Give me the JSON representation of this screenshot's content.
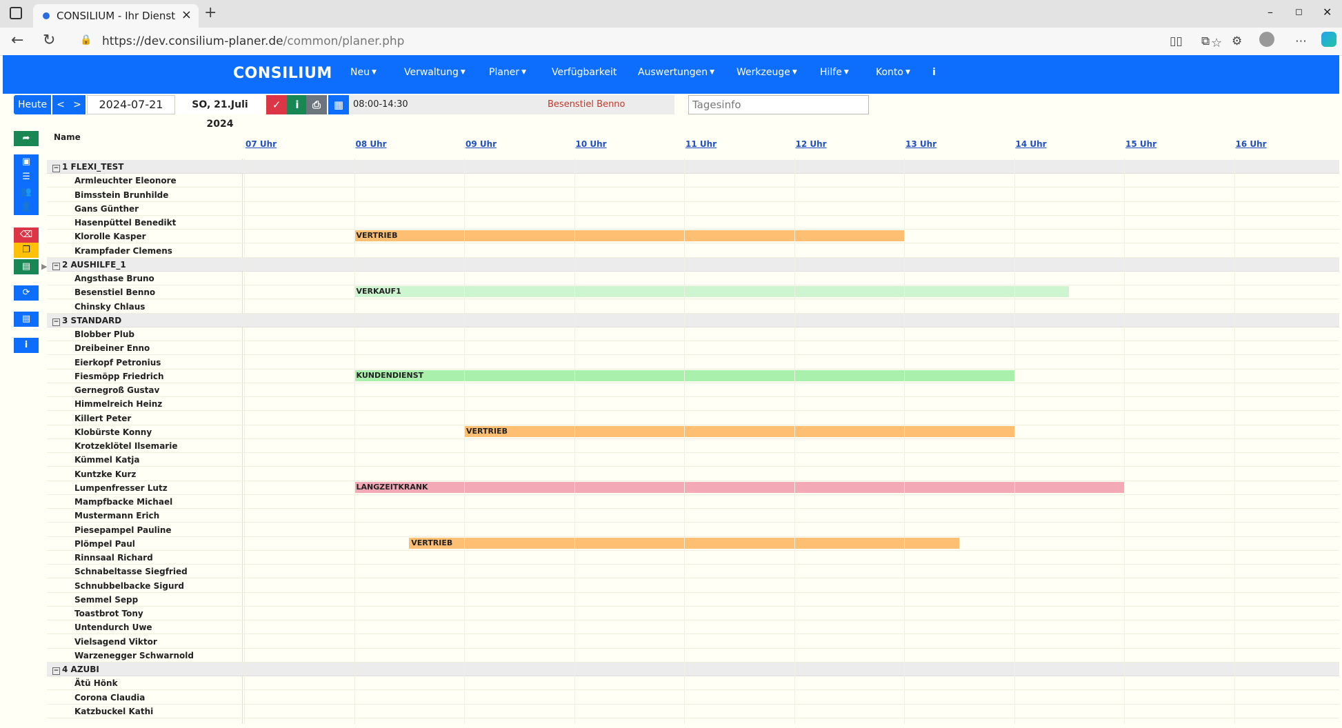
{
  "browser": {
    "tab_title": "CONSILIUM - Ihr Dienstpl",
    "url_host": "https://dev.consilium-planer.de",
    "url_path": "/common/planer.php"
  },
  "app": {
    "brand": "CONSILIUM",
    "menu": [
      {
        "label": "Neu",
        "has_caret": true
      },
      {
        "label": "Verwaltung",
        "has_caret": true
      },
      {
        "label": "Planer",
        "has_caret": true
      },
      {
        "label": "Verfügbarkeit",
        "has_caret": false
      },
      {
        "label": "Auswertungen",
        "has_caret": true
      },
      {
        "label": "Werkzeuge",
        "has_caret": true
      },
      {
        "label": "Hilfe",
        "has_caret": true
      },
      {
        "label": "Konto",
        "has_caret": true
      },
      {
        "label": "i",
        "has_caret": false
      }
    ]
  },
  "toolbar": {
    "today": "Heute",
    "prev": "<",
    "next": ">",
    "date": "2024-07-21",
    "day_label": "SO, 21.Juli 2024",
    "info_time": "08:00-14:30",
    "info_employee": "Besenstiel Benno",
    "tagesinfo_placeholder": "Tagesinfo",
    "colors": {
      "primary": "#0d6efd",
      "danger": "#dc3545",
      "success": "#198754",
      "secondary": "#6c757d"
    }
  },
  "planner": {
    "name_header": "Name",
    "hours": [
      "07 Uhr",
      "08 Uhr",
      "09 Uhr",
      "10 Uhr",
      "11 Uhr",
      "12 Uhr",
      "13 Uhr",
      "14 Uhr",
      "15 Uhr",
      "16 Uhr"
    ],
    "rows": [
      {
        "type": "group",
        "label": "1 FLEXI_TEST",
        "collapse": "−"
      },
      {
        "type": "emp",
        "label": "Armleuchter Eleonore"
      },
      {
        "type": "emp",
        "label": "Bimsstein Brunhilde"
      },
      {
        "type": "emp",
        "label": "Gans Günther"
      },
      {
        "type": "emp",
        "label": "Hasenpüttel Benedikt"
      },
      {
        "type": "emp",
        "label": "Klorolle Kasper",
        "shift": {
          "label": "VERTRIEB",
          "start": "08:00",
          "end": "13:00",
          "color": "#ffbf73"
        }
      },
      {
        "type": "emp",
        "label": "Krampfader Clemens"
      },
      {
        "type": "group",
        "label": "2 AUSHILFE_1",
        "collapse": "−"
      },
      {
        "type": "emp",
        "label": "Angsthase Bruno"
      },
      {
        "type": "emp",
        "label": "Besenstiel Benno",
        "shift": {
          "label": "VERKAUF1",
          "start": "08:00",
          "end": "14:30",
          "color": "#cdf5cf"
        }
      },
      {
        "type": "emp",
        "label": "Chinsky Chlaus"
      },
      {
        "type": "group",
        "label": "3 STANDARD",
        "collapse": "−"
      },
      {
        "type": "emp",
        "label": "Blobber Plub"
      },
      {
        "type": "emp",
        "label": "Dreibeiner Enno"
      },
      {
        "type": "emp",
        "label": "Eierkopf Petronius"
      },
      {
        "type": "emp",
        "label": "Fiesmöpp Friedrich",
        "shift": {
          "label": "KUNDENDIENST",
          "start": "08:00",
          "end": "14:00",
          "color": "#a8f0ab"
        }
      },
      {
        "type": "emp",
        "label": "Gernegroß Gustav"
      },
      {
        "type": "emp",
        "label": "Himmelreich Heinz"
      },
      {
        "type": "emp",
        "label": "Killert Peter"
      },
      {
        "type": "emp",
        "label": "Klobürste Konny",
        "shift": {
          "label": "VERTRIEB",
          "start": "09:00",
          "end": "14:00",
          "color": "#ffbf73"
        }
      },
      {
        "type": "emp",
        "label": "Krotzeklötel Ilsemarie"
      },
      {
        "type": "emp",
        "label": "Kümmel Katja"
      },
      {
        "type": "emp",
        "label": "Kuntzke Kurz"
      },
      {
        "type": "emp",
        "label": "Lumpenfresser Lutz",
        "shift": {
          "label": "LANGZEITKRANK",
          "start": "08:00",
          "end": "15:00",
          "color": "#f4a9b6"
        }
      },
      {
        "type": "emp",
        "label": "Mampfbacke Michael"
      },
      {
        "type": "emp",
        "label": "Mustermann Erich"
      },
      {
        "type": "emp",
        "label": "Piesepampel Pauline"
      },
      {
        "type": "emp",
        "label": "Plömpel Paul",
        "shift": {
          "label": "VERTRIEB",
          "start": "08:30",
          "end": "13:30",
          "color": "#ffbf73"
        }
      },
      {
        "type": "emp",
        "label": "Rinnsaal Richard"
      },
      {
        "type": "emp",
        "label": "Schnabeltasse Siegfried"
      },
      {
        "type": "emp",
        "label": "Schnubbelbacke Sigurd"
      },
      {
        "type": "emp",
        "label": "Semmel Sepp"
      },
      {
        "type": "emp",
        "label": "Toastbrot Tony"
      },
      {
        "type": "emp",
        "label": "Untendurch Uwe"
      },
      {
        "type": "emp",
        "label": "Vielsagend Viktor"
      },
      {
        "type": "emp",
        "label": "Warzenegger Schwarnold"
      },
      {
        "type": "group",
        "label": "4 AZUBI",
        "collapse": "−"
      },
      {
        "type": "emp",
        "label": "Ätü Hönk"
      },
      {
        "type": "emp",
        "label": "Corona Claudia"
      },
      {
        "type": "emp",
        "label": "Katzbuckel Kathi"
      }
    ]
  },
  "sidebar_icons": [
    "share-icon",
    "calendar-icon",
    "list-icon",
    "users-icon",
    "user-remove-icon",
    "eraser-icon",
    "copy-icon",
    "paste-icon",
    "refresh-icon",
    "pdf-icon",
    "info-icon"
  ]
}
